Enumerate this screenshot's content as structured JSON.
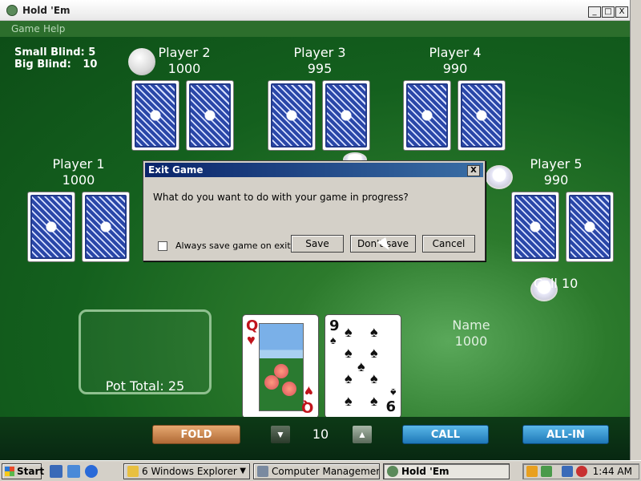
{
  "window": {
    "title": "Hold 'Em",
    "minimize": "_",
    "maximize": "□",
    "close": "X"
  },
  "menu": {
    "items": [
      "Game",
      "Help"
    ]
  },
  "blinds": {
    "small": "Small Blind: 5",
    "big_label": "Big Blind:",
    "big_value": "10"
  },
  "players": [
    {
      "name": "Player 1",
      "chips": "1000"
    },
    {
      "name": "Player 2",
      "chips": "1000"
    },
    {
      "name": "Player 3",
      "chips": "995"
    },
    {
      "name": "Player 4",
      "chips": "990"
    },
    {
      "name": "Player 5",
      "chips": "990"
    }
  ],
  "pot": {
    "label": "Pot Total: 25"
  },
  "hero": {
    "name": "Name",
    "chips": "1000",
    "action": "Call 10"
  },
  "hand": [
    {
      "rank": "Q",
      "suit": "hearts",
      "color": "#c0141c"
    },
    {
      "rank": "9",
      "suit": "spades",
      "color": "#111111"
    }
  ],
  "hand_corner": {
    "queen_bottom": "Q",
    "nine_bottom": "6"
  },
  "controls": {
    "fold": "FOLD",
    "bet": "10",
    "call": "CALL",
    "allin": "ALL-IN"
  },
  "dialog": {
    "title": "Exit Game",
    "close": "X",
    "message": "What do you want to do with your game in progress?",
    "checkbox_label": "Always save game on exit",
    "checkbox_checked": false,
    "save": "Save",
    "dont_save": "Don't save",
    "cancel": "Cancel"
  },
  "taskbar": {
    "start": "Start",
    "tasks": [
      {
        "label": "6 Windows Explorer",
        "active": false
      },
      {
        "label": "Computer Management",
        "active": false
      },
      {
        "label": "Hold 'Em",
        "active": true
      }
    ],
    "clock": "1:44 AM"
  },
  "colors": {
    "felt": "#14601e",
    "fold": "#c07a44",
    "call": "#2a88c8",
    "dialog_title": "#0a246a"
  }
}
